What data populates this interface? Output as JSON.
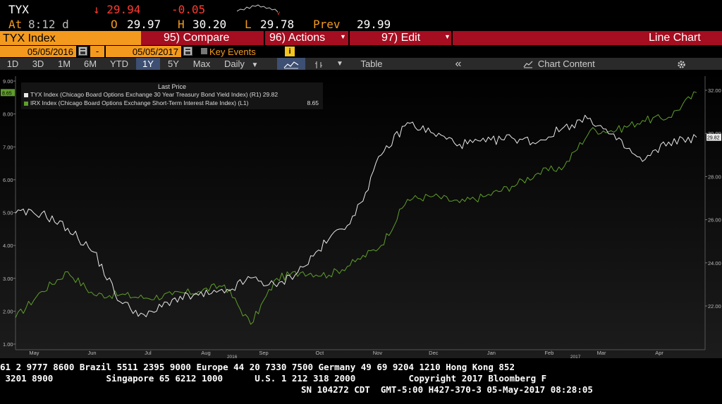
{
  "quote": {
    "symbol": "TYX",
    "at_label": "At",
    "time": "8:12 d",
    "last": "↓ 29.94",
    "change": "-0.05",
    "open_label": "O",
    "open": "29.97",
    "high_label": "H",
    "high": "30.20",
    "low_label": "L",
    "low": "29.78",
    "prev_label": "Prev",
    "prev": "29.99",
    "colors": {
      "down": "#ff3b30",
      "label": "#f39a1e"
    }
  },
  "menu": {
    "security": "TYX Index",
    "compare": "95) Compare",
    "actions": "96) Actions",
    "edit": "97) Edit",
    "chart_type": "Line Chart"
  },
  "dates": {
    "start": "05/05/2016",
    "separator": "-",
    "end": "05/05/2017",
    "key_events": "Key Events",
    "info_glyph": "i"
  },
  "toolbar": {
    "ranges": [
      "1D",
      "3D",
      "1M",
      "6M",
      "YTD",
      "1Y",
      "5Y",
      "Max"
    ],
    "active_range": "1Y",
    "frequency": "Daily",
    "table": "Table",
    "collapse": "«",
    "chart_content": "Chart Content",
    "icons": [
      "line-chart-icon",
      "bar-style-icon",
      "dropdown-arrow-icon",
      "collapse-icon",
      "chart-content-icon",
      "gear-icon"
    ]
  },
  "legend": {
    "title": "Last Price",
    "tyx_label": "TYX Index (Chicago Board Options Exchange 30 Year Treasury Bond Yield Index)  (R1) 29.82",
    "irx_label": "IRX Index (Chicago Board Options Exchange Short-Term Interest Rate Index)  (L1)",
    "irx_value": "8.65"
  },
  "chart_data": {
    "type": "line",
    "x": [
      "2016-05-05",
      "2016-05-19",
      "2016-06-02",
      "2016-06-16",
      "2016-06-30",
      "2016-07-14",
      "2016-07-28",
      "2016-08-11",
      "2016-08-25",
      "2016-09-08",
      "2016-09-22",
      "2016-10-06",
      "2016-10-20",
      "2016-11-03",
      "2016-11-17",
      "2016-12-01",
      "2016-12-15",
      "2016-12-29",
      "2017-01-12",
      "2017-01-26",
      "2017-02-09",
      "2017-02-23",
      "2017-03-09",
      "2017-03-23",
      "2017-04-06",
      "2017-04-20",
      "2017-05-05"
    ],
    "series": [
      {
        "name": "IRX Index (Chicago Board Options Exchange Short-Term Interest Rate Index)",
        "axis": "left",
        "color": "#5f9e2a",
        "values": [
          1.8,
          2.6,
          3.2,
          2.5,
          2.5,
          2.4,
          2.5,
          2.6,
          2.8,
          1.6,
          3.0,
          3.2,
          3.1,
          3.5,
          4.0,
          5.4,
          5.5,
          5.3,
          5.5,
          5.8,
          6.2,
          6.4,
          7.5,
          7.5,
          7.8,
          7.9,
          8.65
        ]
      },
      {
        "name": "TYX Index (Chicago Board Options Exchange 30 Year Treasury Bond Yield Index)",
        "axis": "right",
        "color": "#e8e8e8",
        "values": [
          26.3,
          26.3,
          25.6,
          24.5,
          22.2,
          21.5,
          22.3,
          22.5,
          22.6,
          23.3,
          22.9,
          23.8,
          25.1,
          26.2,
          29.0,
          30.5,
          30.0,
          29.5,
          29.6,
          29.8,
          29.6,
          30.3,
          30.7,
          29.7,
          28.7,
          29.6,
          29.82
        ]
      }
    ],
    "left_axis": {
      "ticks": [
        "9.00",
        "8.00",
        "7.00",
        "6.00",
        "5.00",
        "4.00",
        "3.00",
        "2.00",
        "1.00"
      ],
      "range": [
        1,
        9
      ]
    },
    "right_axis": {
      "ticks": [
        "32.00",
        "30.00",
        "28.00",
        "26.00",
        "24.00",
        "22.00"
      ],
      "range": [
        20.4,
        32.6
      ]
    },
    "month_labels": [
      "May",
      "Jun",
      "Jul",
      "Aug",
      "Sep",
      "Oct",
      "Nov",
      "Dec",
      "Jan",
      "Feb",
      "Mar",
      "Apr"
    ],
    "year_labels": [
      "2016",
      "2017"
    ],
    "last_value_tags": {
      "left": "8.65",
      "right": "29.82"
    },
    "grid": false,
    "legend_placement": "top-left"
  },
  "tape": {
    "line1": "61 2 9777 8600 Brazil 5511 2395 9000 Europe 44 20 7330 7500 Germany 49 69 9204 1210 Hong Kong 852",
    "line2": " 3201 8900          Singapore 65 6212 1000      U.S. 1 212 318 2000          Copyright 2017 Bloomberg F",
    "line3": "SN 104272 CDT  GMT-5:00 H427-370-3 05-May-2017 08:28:05"
  }
}
